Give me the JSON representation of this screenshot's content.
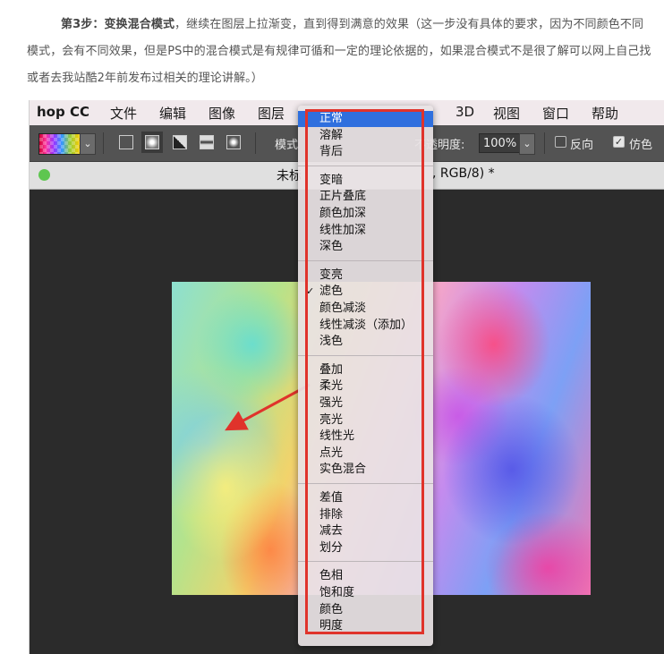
{
  "article": {
    "line1_bold": "第3步：变换混合模式",
    "line1_rest": "，继续在图层上拉渐变，直到得到满意的效果（这一步没有具体的要求，因为不同颜色不同",
    "line2": "模式，会有不同效果，但是PS中的混合模式是有规律可循和一定的理论依据的，如果混合模式不是很了解可以网上自己找",
    "line3": "或者去我站酷2年前发布过相关的理论讲解。）"
  },
  "menubar": {
    "app": "hop CC",
    "file": "文件",
    "edit": "编辑",
    "image": "图像",
    "layer": "图层",
    "three_d": "3D",
    "view": "视图",
    "window": "窗口",
    "help": "帮助"
  },
  "options": {
    "mode_label": "模式",
    "opacity_label": "不透明度:",
    "opacity_value": "100%",
    "reverse_label": "反向",
    "dither_label": "仿色",
    "reverse_checked": false,
    "dither_checked": true
  },
  "doctab": {
    "title_left": "未标",
    "title_right": ", RGB/8) *"
  },
  "blend_menu": {
    "selected": "正常",
    "checked": "滤色",
    "groups": [
      [
        "正常",
        "溶解",
        "背后"
      ],
      [
        "变暗",
        "正片叠底",
        "颜色加深",
        "线性加深",
        "深色"
      ],
      [
        "变亮",
        "滤色",
        "颜色减淡",
        "线性减淡（添加）",
        "浅色"
      ],
      [
        "叠加",
        "柔光",
        "强光",
        "亮光",
        "线性光",
        "点光",
        "实色混合"
      ],
      [
        "差值",
        "排除",
        "减去",
        "划分"
      ],
      [
        "色相",
        "饱和度",
        "颜色",
        "明度"
      ]
    ]
  },
  "colors": {
    "highlight": "#2f6fde",
    "annotation_red": "#e0332b",
    "status_green": "#5ec650"
  }
}
